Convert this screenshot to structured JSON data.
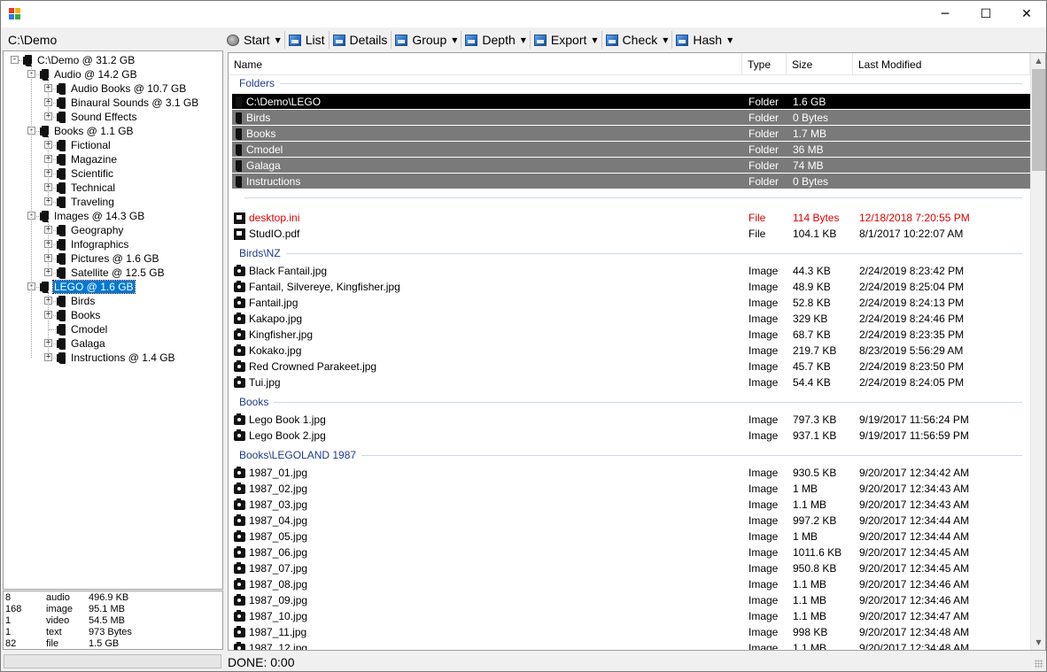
{
  "window": {
    "controls": {
      "minimize": "─",
      "maximize": "☐",
      "close": "✕"
    }
  },
  "path": "C:\\Demo",
  "toolbar": [
    {
      "label": "Start",
      "icon": "start-icon",
      "dropdown": true
    },
    {
      "label": "List",
      "icon": "list-icon",
      "dropdown": false
    },
    {
      "label": "Details",
      "icon": "details-icon",
      "dropdown": false
    },
    {
      "label": "Group",
      "icon": "group-icon",
      "dropdown": true
    },
    {
      "label": "Depth",
      "icon": "depth-icon",
      "dropdown": true
    },
    {
      "label": "Export",
      "icon": "export-icon",
      "dropdown": true
    },
    {
      "label": "Check",
      "icon": "check-icon",
      "dropdown": true
    },
    {
      "label": "Hash",
      "icon": "hash-icon",
      "dropdown": true
    }
  ],
  "tree": [
    {
      "label": "C:\\Demo @ 31.2 GB",
      "level": 0,
      "expander": "−"
    },
    {
      "label": "Audio @ 14.2 GB",
      "level": 1,
      "expander": "−"
    },
    {
      "label": "Audio Books @ 10.7 GB",
      "level": 2,
      "expander": "+"
    },
    {
      "label": "Binaural Sounds @ 3.1 GB",
      "level": 2,
      "expander": "+"
    },
    {
      "label": "Sound Effects",
      "level": 2,
      "expander": "+"
    },
    {
      "label": "Books @ 1.1 GB",
      "level": 1,
      "expander": "−"
    },
    {
      "label": "Fictional",
      "level": 2,
      "expander": "+"
    },
    {
      "label": "Magazine",
      "level": 2,
      "expander": "+"
    },
    {
      "label": "Scientific",
      "level": 2,
      "expander": "+"
    },
    {
      "label": "Technical",
      "level": 2,
      "expander": "+"
    },
    {
      "label": "Traveling",
      "level": 2,
      "expander": "+"
    },
    {
      "label": "Images @ 14.3 GB",
      "level": 1,
      "expander": "−"
    },
    {
      "label": "Geography",
      "level": 2,
      "expander": "+"
    },
    {
      "label": "Infographics",
      "level": 2,
      "expander": "+"
    },
    {
      "label": "Pictures @ 1.6 GB",
      "level": 2,
      "expander": "+"
    },
    {
      "label": "Satellite @ 12.5 GB",
      "level": 2,
      "expander": "+"
    },
    {
      "label": "LEGO @ 1.6 GB",
      "level": 1,
      "expander": "−",
      "selected": true
    },
    {
      "label": "Birds",
      "level": 2,
      "expander": "+"
    },
    {
      "label": "Books",
      "level": 2,
      "expander": "+"
    },
    {
      "label": "Cmodel",
      "level": 2,
      "expander": ""
    },
    {
      "label": "Galaga",
      "level": 2,
      "expander": "+"
    },
    {
      "label": "Instructions @ 1.4 GB",
      "level": 2,
      "expander": "+"
    }
  ],
  "stats": [
    {
      "count": "8",
      "type": "audio",
      "size": "496.9 KB"
    },
    {
      "count": "168",
      "type": "image",
      "size": "95.1 MB"
    },
    {
      "count": "1",
      "type": "video",
      "size": "54.5 MB"
    },
    {
      "count": "1",
      "type": "text",
      "size": "973 Bytes"
    },
    {
      "count": "82",
      "type": "file",
      "size": "1.5 GB"
    }
  ],
  "columns": [
    "Name",
    "Type",
    "Size",
    "Last Modified"
  ],
  "groups": [
    {
      "title": "Folders",
      "rows": [
        {
          "name": "C:\\Demo\\LEGO",
          "type": "Folder",
          "size": "1.6 GB",
          "modified": "",
          "icon": "folder",
          "state": "selected"
        },
        {
          "name": "Birds",
          "type": "Folder",
          "size": "0 Bytes",
          "modified": "",
          "icon": "folder",
          "state": "folder"
        },
        {
          "name": "Books",
          "type": "Folder",
          "size": "1.7 MB",
          "modified": "",
          "icon": "folder",
          "state": "folder"
        },
        {
          "name": "Cmodel",
          "type": "Folder",
          "size": "36 MB",
          "modified": "",
          "icon": "folder",
          "state": "folder"
        },
        {
          "name": "Galaga",
          "type": "Folder",
          "size": "74 MB",
          "modified": "",
          "icon": "folder",
          "state": "folder"
        },
        {
          "name": "Instructions",
          "type": "Folder",
          "size": "0 Bytes",
          "modified": "",
          "icon": "folder",
          "state": "folder"
        }
      ]
    },
    {
      "title": "",
      "rows": [
        {
          "name": "desktop.ini",
          "type": "File",
          "size": "114 Bytes",
          "modified": "12/18/2018 7:20:55 PM",
          "icon": "doc",
          "state": "red"
        },
        {
          "name": "StudIO.pdf",
          "type": "File",
          "size": "104.1 KB",
          "modified": "8/1/2017 10:22:07 AM",
          "icon": "doc",
          "state": ""
        }
      ]
    },
    {
      "title": "Birds\\NZ",
      "rows": [
        {
          "name": "Black Fantail.jpg",
          "type": "Image",
          "size": "44.3 KB",
          "modified": "2/24/2019 8:23:42 PM",
          "icon": "cam",
          "state": ""
        },
        {
          "name": "Fantail, Silvereye, Kingfisher.jpg",
          "type": "Image",
          "size": "48.9 KB",
          "modified": "2/24/2019 8:25:04 PM",
          "icon": "cam",
          "state": ""
        },
        {
          "name": "Fantail.jpg",
          "type": "Image",
          "size": "52.8 KB",
          "modified": "2/24/2019 8:24:13 PM",
          "icon": "cam",
          "state": ""
        },
        {
          "name": "Kakapo.jpg",
          "type": "Image",
          "size": "329 KB",
          "modified": "2/24/2019 8:24:46 PM",
          "icon": "cam",
          "state": ""
        },
        {
          "name": "Kingfisher.jpg",
          "type": "Image",
          "size": "68.7 KB",
          "modified": "2/24/2019 8:23:35 PM",
          "icon": "cam",
          "state": ""
        },
        {
          "name": "Kokako.jpg",
          "type": "Image",
          "size": "219.7 KB",
          "modified": "8/23/2019 5:56:29 AM",
          "icon": "cam",
          "state": ""
        },
        {
          "name": "Red Crowned Parakeet.jpg",
          "type": "Image",
          "size": "45.7 KB",
          "modified": "2/24/2019 8:23:50 PM",
          "icon": "cam",
          "state": ""
        },
        {
          "name": "Tui.jpg",
          "type": "Image",
          "size": "54.4 KB",
          "modified": "2/24/2019 8:24:05 PM",
          "icon": "cam",
          "state": ""
        }
      ]
    },
    {
      "title": "Books",
      "rows": [
        {
          "name": "Lego Book 1.jpg",
          "type": "Image",
          "size": "797.3 KB",
          "modified": "9/19/2017 11:56:24 PM",
          "icon": "cam",
          "state": ""
        },
        {
          "name": "Lego Book 2.jpg",
          "type": "Image",
          "size": "937.1 KB",
          "modified": "9/19/2017 11:56:59 PM",
          "icon": "cam",
          "state": ""
        }
      ]
    },
    {
      "title": "Books\\LEGOLAND 1987",
      "rows": [
        {
          "name": "1987_01.jpg",
          "type": "Image",
          "size": "930.5 KB",
          "modified": "9/20/2017 12:34:42 AM",
          "icon": "cam",
          "state": ""
        },
        {
          "name": "1987_02.jpg",
          "type": "Image",
          "size": "1 MB",
          "modified": "9/20/2017 12:34:43 AM",
          "icon": "cam",
          "state": ""
        },
        {
          "name": "1987_03.jpg",
          "type": "Image",
          "size": "1.1 MB",
          "modified": "9/20/2017 12:34:43 AM",
          "icon": "cam",
          "state": ""
        },
        {
          "name": "1987_04.jpg",
          "type": "Image",
          "size": "997.2 KB",
          "modified": "9/20/2017 12:34:44 AM",
          "icon": "cam",
          "state": ""
        },
        {
          "name": "1987_05.jpg",
          "type": "Image",
          "size": "1 MB",
          "modified": "9/20/2017 12:34:44 AM",
          "icon": "cam",
          "state": ""
        },
        {
          "name": "1987_06.jpg",
          "type": "Image",
          "size": "1011.6 KB",
          "modified": "9/20/2017 12:34:45 AM",
          "icon": "cam",
          "state": ""
        },
        {
          "name": "1987_07.jpg",
          "type": "Image",
          "size": "950.8 KB",
          "modified": "9/20/2017 12:34:45 AM",
          "icon": "cam",
          "state": ""
        },
        {
          "name": "1987_08.jpg",
          "type": "Image",
          "size": "1.1 MB",
          "modified": "9/20/2017 12:34:46 AM",
          "icon": "cam",
          "state": ""
        },
        {
          "name": "1987_09.jpg",
          "type": "Image",
          "size": "1.1 MB",
          "modified": "9/20/2017 12:34:46 AM",
          "icon": "cam",
          "state": ""
        },
        {
          "name": "1987_10.jpg",
          "type": "Image",
          "size": "1.1 MB",
          "modified": "9/20/2017 12:34:47 AM",
          "icon": "cam",
          "state": ""
        },
        {
          "name": "1987_11.jpg",
          "type": "Image",
          "size": "998 KB",
          "modified": "9/20/2017 12:34:48 AM",
          "icon": "cam",
          "state": ""
        },
        {
          "name": "1987_12.jpg",
          "type": "Image",
          "size": "1.1 MB",
          "modified": "9/20/2017 12:34:48 AM",
          "icon": "cam",
          "state": ""
        }
      ]
    }
  ],
  "status": "DONE: 0:00",
  "colors": {
    "selection": "#0078d7",
    "group_title": "#1e3a8a",
    "folder_row": "#7a7a7a",
    "error_text": "#e00000"
  }
}
